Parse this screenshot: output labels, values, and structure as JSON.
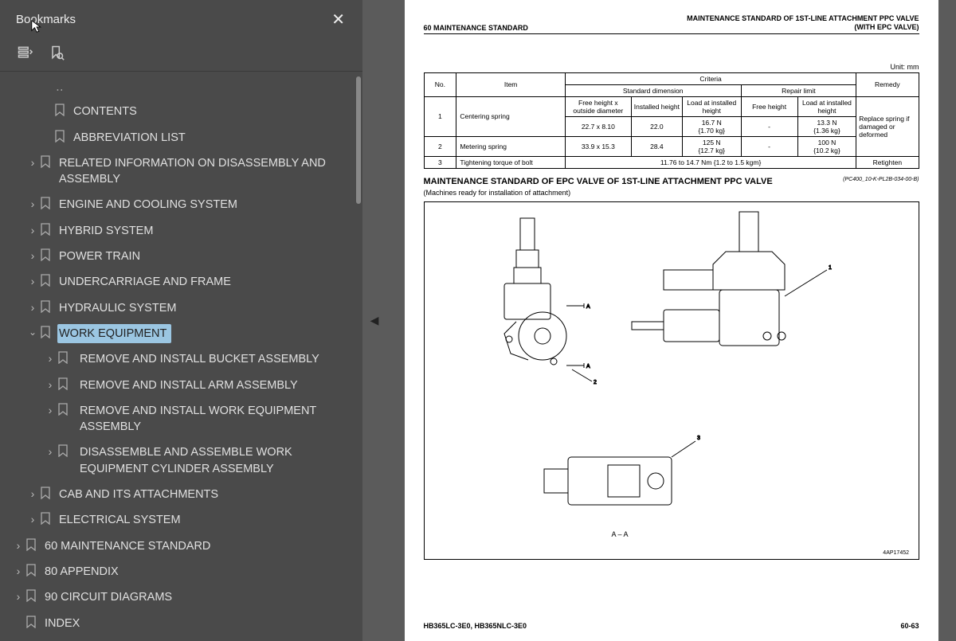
{
  "sidebar": {
    "title": "Bookmarks",
    "bookmarks_level1": [
      {
        "label": "CONTENTS",
        "chev": "none",
        "depth_class": "depth2"
      },
      {
        "label": "ABBREVIATION LIST",
        "chev": "none",
        "depth_class": "depth2"
      },
      {
        "label": "RELATED INFORMATION ON DISASSEMBLY AND ASSEMBLY",
        "chev": "collapsed",
        "depth_class": "depth1"
      },
      {
        "label": "ENGINE AND COOLING SYSTEM",
        "chev": "collapsed",
        "depth_class": "depth1"
      },
      {
        "label": "HYBRID SYSTEM",
        "chev": "collapsed",
        "depth_class": "depth1"
      },
      {
        "label": "POWER TRAIN",
        "chev": "collapsed",
        "depth_class": "depth1"
      },
      {
        "label": "UNDERCARRIAGE AND FRAME",
        "chev": "collapsed",
        "depth_class": "depth1"
      },
      {
        "label": "HYDRAULIC SYSTEM",
        "chev": "collapsed",
        "depth_class": "depth1"
      }
    ],
    "work_equipment": {
      "label": "WORK EQUIPMENT"
    },
    "work_children": [
      {
        "label": "REMOVE AND INSTALL BUCKET ASSEMBLY",
        "chev": "collapsed"
      },
      {
        "label": "REMOVE AND INSTALL ARM ASSEMBLY",
        "chev": "collapsed"
      },
      {
        "label": "REMOVE AND INSTALL WORK EQUIPMENT ASSEMBLY",
        "chev": "collapsed"
      },
      {
        "label": "DISASSEMBLE AND ASSEMBLE WORK EQUIPMENT CYLINDER ASSEMBLY",
        "chev": "collapsed"
      }
    ],
    "bookmarks_after": [
      {
        "label": "CAB AND ITS ATTACHMENTS",
        "chev": "collapsed",
        "depth_class": "depth1"
      },
      {
        "label": "ELECTRICAL SYSTEM",
        "chev": "collapsed",
        "depth_class": "depth1"
      }
    ],
    "bookmarks_root": [
      {
        "label": "60 MAINTENANCE STANDARD",
        "chev": "collapsed"
      },
      {
        "label": "80 APPENDIX",
        "chev": "collapsed"
      },
      {
        "label": "90 CIRCUIT DIAGRAMS",
        "chev": "collapsed"
      },
      {
        "label": "INDEX",
        "chev": "none"
      }
    ]
  },
  "page": {
    "header_left": "60 MAINTENANCE STANDARD",
    "header_right_1": "MAINTENANCE STANDARD OF 1ST-LINE ATTACHMENT PPC VALVE",
    "header_right_2": "(WITH EPC VALVE)",
    "unit": "Unit: mm",
    "table": {
      "col_no": "No.",
      "col_item": "Item",
      "col_criteria": "Criteria",
      "col_remedy": "Remedy",
      "col_std": "Standard dimension",
      "col_repair": "Repair limit",
      "col_fh_outside": "Free height x outside diameter",
      "col_inst_h": "Installed height",
      "col_load_inst": "Load at installed height",
      "col_fh": "Free height",
      "col_load_inst2": "Load at installed height",
      "row1_no": "1",
      "row1_item": "Centering spring",
      "row1_v1": "22.7 x 8.10",
      "row1_v2": "22.0",
      "row1_v3a": "16.7 N",
      "row1_v3b": "{1.70 kg}",
      "row1_v4": "-",
      "row1_v5a": "13.3 N",
      "row1_v5b": "{1.36 kg}",
      "remedy1": "Replace spring if damaged or deformed",
      "row2_no": "2",
      "row2_item": "Metering spring",
      "row2_v1": "33.9 x 15.3",
      "row2_v2": "28.4",
      "row2_v3a": "125 N",
      "row2_v3b": "{12.7 kg}",
      "row2_v4": "-",
      "row2_v5a": "100 N",
      "row2_v5b": "{10.2 kg}",
      "row3_no": "3",
      "row3_item": "Tightening torque of bolt",
      "row3_val": "11.76 to 14.7 Nm {1.2 to 1.5 kgm}",
      "row3_remedy": "Retighten"
    },
    "section_title": "MAINTENANCE STANDARD OF EPC VALVE OF 1ST-LINE ATTACHMENT PPC VALVE",
    "section_code": "(PC400_10-K-PL2B-034-00-B)",
    "section_note": "(Machines ready for installation of attachment)",
    "diagram_label_aa": "A – A",
    "diagram_code": "4AP17452",
    "footer_left": "HB365LC-3E0, HB365NLC-3E0",
    "footer_right": "60-63"
  }
}
